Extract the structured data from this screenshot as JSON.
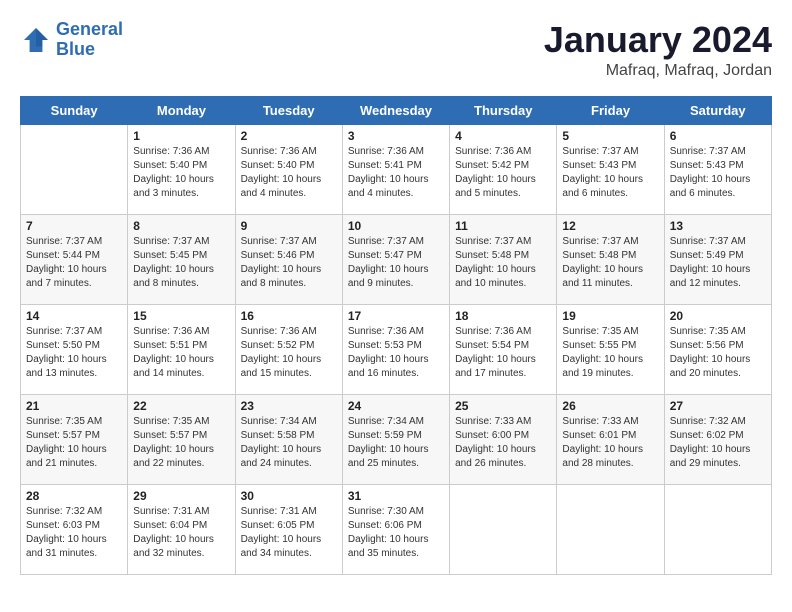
{
  "header": {
    "logo_line1": "General",
    "logo_line2": "Blue",
    "month": "January 2024",
    "location": "Mafraq, Mafraq, Jordan"
  },
  "days_of_week": [
    "Sunday",
    "Monday",
    "Tuesday",
    "Wednesday",
    "Thursday",
    "Friday",
    "Saturday"
  ],
  "weeks": [
    [
      {
        "num": "",
        "info": ""
      },
      {
        "num": "1",
        "info": "Sunrise: 7:36 AM\nSunset: 5:40 PM\nDaylight: 10 hours\nand 3 minutes."
      },
      {
        "num": "2",
        "info": "Sunrise: 7:36 AM\nSunset: 5:40 PM\nDaylight: 10 hours\nand 4 minutes."
      },
      {
        "num": "3",
        "info": "Sunrise: 7:36 AM\nSunset: 5:41 PM\nDaylight: 10 hours\nand 4 minutes."
      },
      {
        "num": "4",
        "info": "Sunrise: 7:36 AM\nSunset: 5:42 PM\nDaylight: 10 hours\nand 5 minutes."
      },
      {
        "num": "5",
        "info": "Sunrise: 7:37 AM\nSunset: 5:43 PM\nDaylight: 10 hours\nand 6 minutes."
      },
      {
        "num": "6",
        "info": "Sunrise: 7:37 AM\nSunset: 5:43 PM\nDaylight: 10 hours\nand 6 minutes."
      }
    ],
    [
      {
        "num": "7",
        "info": "Sunrise: 7:37 AM\nSunset: 5:44 PM\nDaylight: 10 hours\nand 7 minutes."
      },
      {
        "num": "8",
        "info": "Sunrise: 7:37 AM\nSunset: 5:45 PM\nDaylight: 10 hours\nand 8 minutes."
      },
      {
        "num": "9",
        "info": "Sunrise: 7:37 AM\nSunset: 5:46 PM\nDaylight: 10 hours\nand 8 minutes."
      },
      {
        "num": "10",
        "info": "Sunrise: 7:37 AM\nSunset: 5:47 PM\nDaylight: 10 hours\nand 9 minutes."
      },
      {
        "num": "11",
        "info": "Sunrise: 7:37 AM\nSunset: 5:48 PM\nDaylight: 10 hours\nand 10 minutes."
      },
      {
        "num": "12",
        "info": "Sunrise: 7:37 AM\nSunset: 5:48 PM\nDaylight: 10 hours\nand 11 minutes."
      },
      {
        "num": "13",
        "info": "Sunrise: 7:37 AM\nSunset: 5:49 PM\nDaylight: 10 hours\nand 12 minutes."
      }
    ],
    [
      {
        "num": "14",
        "info": "Sunrise: 7:37 AM\nSunset: 5:50 PM\nDaylight: 10 hours\nand 13 minutes."
      },
      {
        "num": "15",
        "info": "Sunrise: 7:36 AM\nSunset: 5:51 PM\nDaylight: 10 hours\nand 14 minutes."
      },
      {
        "num": "16",
        "info": "Sunrise: 7:36 AM\nSunset: 5:52 PM\nDaylight: 10 hours\nand 15 minutes."
      },
      {
        "num": "17",
        "info": "Sunrise: 7:36 AM\nSunset: 5:53 PM\nDaylight: 10 hours\nand 16 minutes."
      },
      {
        "num": "18",
        "info": "Sunrise: 7:36 AM\nSunset: 5:54 PM\nDaylight: 10 hours\nand 17 minutes."
      },
      {
        "num": "19",
        "info": "Sunrise: 7:35 AM\nSunset: 5:55 PM\nDaylight: 10 hours\nand 19 minutes."
      },
      {
        "num": "20",
        "info": "Sunrise: 7:35 AM\nSunset: 5:56 PM\nDaylight: 10 hours\nand 20 minutes."
      }
    ],
    [
      {
        "num": "21",
        "info": "Sunrise: 7:35 AM\nSunset: 5:57 PM\nDaylight: 10 hours\nand 21 minutes."
      },
      {
        "num": "22",
        "info": "Sunrise: 7:35 AM\nSunset: 5:57 PM\nDaylight: 10 hours\nand 22 minutes."
      },
      {
        "num": "23",
        "info": "Sunrise: 7:34 AM\nSunset: 5:58 PM\nDaylight: 10 hours\nand 24 minutes."
      },
      {
        "num": "24",
        "info": "Sunrise: 7:34 AM\nSunset: 5:59 PM\nDaylight: 10 hours\nand 25 minutes."
      },
      {
        "num": "25",
        "info": "Sunrise: 7:33 AM\nSunset: 6:00 PM\nDaylight: 10 hours\nand 26 minutes."
      },
      {
        "num": "26",
        "info": "Sunrise: 7:33 AM\nSunset: 6:01 PM\nDaylight: 10 hours\nand 28 minutes."
      },
      {
        "num": "27",
        "info": "Sunrise: 7:32 AM\nSunset: 6:02 PM\nDaylight: 10 hours\nand 29 minutes."
      }
    ],
    [
      {
        "num": "28",
        "info": "Sunrise: 7:32 AM\nSunset: 6:03 PM\nDaylight: 10 hours\nand 31 minutes."
      },
      {
        "num": "29",
        "info": "Sunrise: 7:31 AM\nSunset: 6:04 PM\nDaylight: 10 hours\nand 32 minutes."
      },
      {
        "num": "30",
        "info": "Sunrise: 7:31 AM\nSunset: 6:05 PM\nDaylight: 10 hours\nand 34 minutes."
      },
      {
        "num": "31",
        "info": "Sunrise: 7:30 AM\nSunset: 6:06 PM\nDaylight: 10 hours\nand 35 minutes."
      },
      {
        "num": "",
        "info": ""
      },
      {
        "num": "",
        "info": ""
      },
      {
        "num": "",
        "info": ""
      }
    ]
  ]
}
